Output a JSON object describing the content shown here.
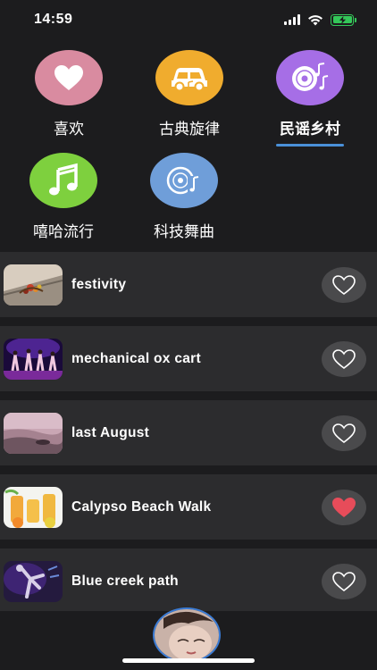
{
  "status": {
    "time": "14:59"
  },
  "categories": [
    {
      "label": "喜欢",
      "icon": "heart-icon",
      "color": "#d98ba0",
      "active": false
    },
    {
      "label": "古典旋律",
      "icon": "car-music-icon",
      "color": "#f0ac2e",
      "active": false
    },
    {
      "label": "民谣乡村",
      "icon": "vinyl-music-icon",
      "color": "#a66ee6",
      "active": true
    },
    {
      "label": "嘻哈流行",
      "icon": "music-note-icon",
      "color": "#7ed03e",
      "active": false
    },
    {
      "label": "科技舞曲",
      "icon": "cd-music-icon",
      "color": "#6f9ed9",
      "active": false
    }
  ],
  "songs": [
    {
      "title": "festivity",
      "liked": false
    },
    {
      "title": "mechanical ox cart",
      "liked": false
    },
    {
      "title": "last August",
      "liked": false
    },
    {
      "title": "Calypso Beach Walk",
      "liked": true
    },
    {
      "title": "Blue creek path",
      "liked": false
    }
  ],
  "colors": {
    "accent": "#4a90d9",
    "liked": "#e74c5a",
    "row_bg": "#2c2c2e",
    "bg": "#1c1c1e"
  }
}
